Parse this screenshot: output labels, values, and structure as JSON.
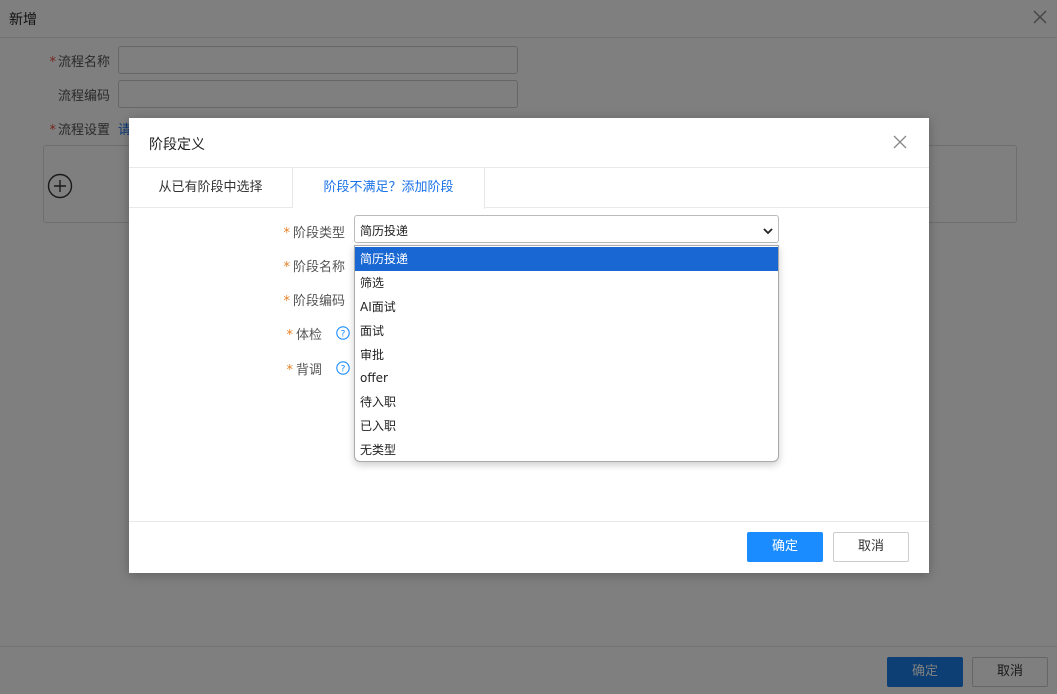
{
  "background": {
    "title": "新增",
    "fields": [
      {
        "required": "*",
        "label": "流程名称",
        "value": ""
      },
      {
        "required": "",
        "label": "流程编码",
        "value": ""
      },
      {
        "required": "*",
        "label": "流程设置",
        "link": "请"
      }
    ],
    "footer": {
      "confirm": "确定",
      "cancel": "取消"
    },
    "icons": {
      "close": "close-icon",
      "add": "plus-circle-icon"
    }
  },
  "dialog": {
    "title": "阶段定义",
    "tabs": [
      {
        "label": "从已有阶段中选择",
        "active": false
      },
      {
        "label": "阶段不满足？添加阶段",
        "active": true
      }
    ],
    "fields": [
      {
        "required": "*",
        "label": "阶段类型"
      },
      {
        "required": "*",
        "label": "阶段名称"
      },
      {
        "required": "*",
        "label": "阶段编码"
      },
      {
        "required": "*",
        "label": "体检",
        "help": true
      },
      {
        "required": "*",
        "label": "背调",
        "help": true
      }
    ],
    "stage_type": {
      "selected": "简历投递",
      "options": [
        "简历投递",
        "筛选",
        "AI面试",
        "面试",
        "审批",
        "offer",
        "待入职",
        "已入职",
        "无类型"
      ]
    },
    "footer": {
      "confirm": "确定",
      "cancel": "取消"
    },
    "colors": {
      "accent": "#1a8cff",
      "selected_option": "#1967d2",
      "required": "#e67e22"
    }
  }
}
